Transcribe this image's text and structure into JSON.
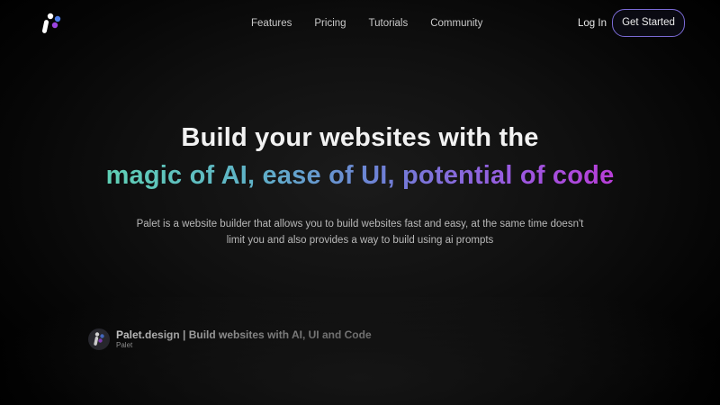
{
  "nav": {
    "menu": [
      {
        "label": "Features"
      },
      {
        "label": "Pricing"
      },
      {
        "label": "Tutorials"
      },
      {
        "label": "Community"
      }
    ],
    "login_label": "Log In",
    "cta_label": "Get Started"
  },
  "hero": {
    "title_line1": "Build your websites with the",
    "title_line2": "magic of AI, ease of UI, potential of code",
    "description": "Palet is a website builder that allows you to build websites fast and easy, at the same time doesn't limit you and also provides a way to build using ai prompts"
  },
  "video_card": {
    "title": "Palet.design | Build websites with AI, UI and Code",
    "channel": "Palet"
  },
  "colors": {
    "background": "#000000",
    "cta_border": "#7b6bd6",
    "gradient_start": "#5fd0b5",
    "gradient_mid": "#6f7fd6",
    "gradient_end": "#b83ed8"
  },
  "icons": {
    "brand_logo": "palet-logo-icon",
    "card_logo": "palet-avatar-icon"
  }
}
